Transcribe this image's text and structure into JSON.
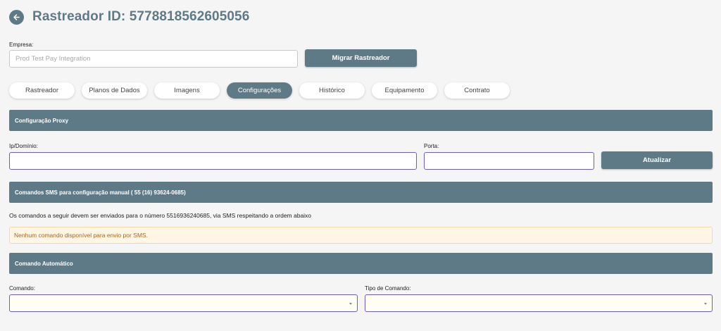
{
  "header": {
    "title": "Rastreador ID: 5778818562605056"
  },
  "company": {
    "label": "Empresa:",
    "value": "Prod Test Pay Integration"
  },
  "migrate_button": "Migrar Rastreador",
  "tabs": [
    {
      "label": "Rastreador"
    },
    {
      "label": "Planos de Dados"
    },
    {
      "label": "Imagens"
    },
    {
      "label": "Configurações"
    },
    {
      "label": "Histórico"
    },
    {
      "label": "Equipamento"
    },
    {
      "label": "Contrato"
    }
  ],
  "active_tab": "Configurações",
  "proxy": {
    "section_title": "Configuração Proxy",
    "ip_label": "Ip/Domínio:",
    "ip_value": "",
    "port_label": "Porta:",
    "port_value": "",
    "update_button": "Atualizar"
  },
  "sms": {
    "section_title": "Comandos SMS para configuração manual ( 55 (16) 93624-0685)",
    "instructions": "Os comandos a seguir devem ser enviados para o número 5516936240685, via SMS respeitando a ordem abaixo",
    "empty_notice": "Nenhum comando disponível para envio por SMS."
  },
  "auto_command": {
    "section_title": "Comando Automático",
    "command_label": "Comando:",
    "command_value": "",
    "type_label": "Tipo de Comando:",
    "type_value": ""
  },
  "colors": {
    "primary": "#5f7a87",
    "background": "#f5f5f5",
    "alert_bg": "#fff6e6",
    "alert_text": "#a8641c",
    "focus_border": "#6a5fc1"
  }
}
